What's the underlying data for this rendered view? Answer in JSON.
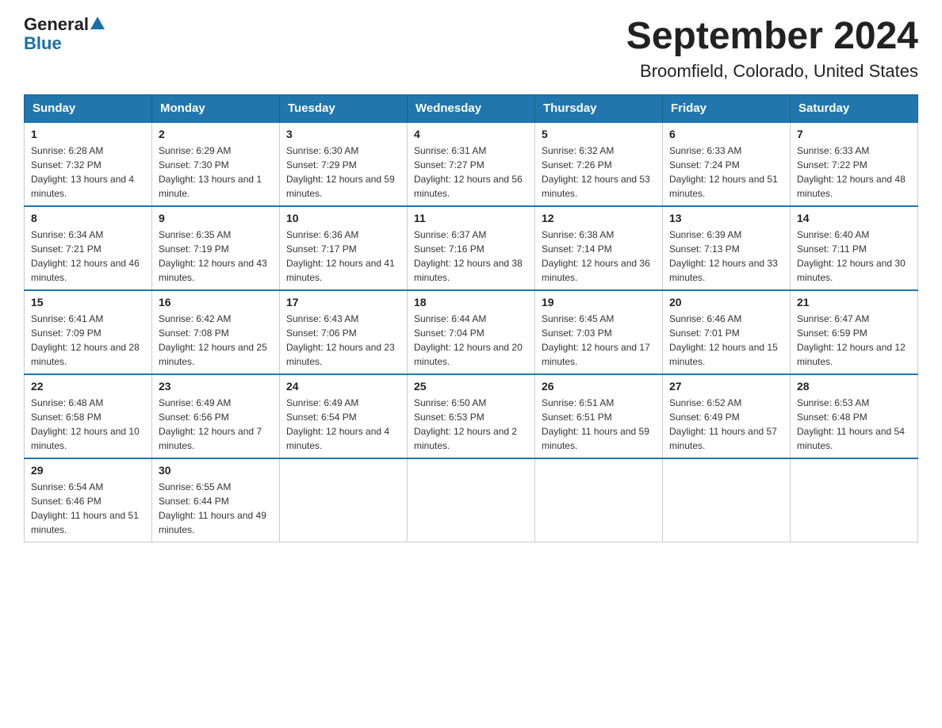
{
  "header": {
    "logo_general": "General",
    "logo_blue": "Blue",
    "title": "September 2024",
    "subtitle": "Broomfield, Colorado, United States"
  },
  "days_of_week": [
    "Sunday",
    "Monday",
    "Tuesday",
    "Wednesday",
    "Thursday",
    "Friday",
    "Saturday"
  ],
  "weeks": [
    [
      {
        "day": "1",
        "sunrise": "6:28 AM",
        "sunset": "7:32 PM",
        "daylight": "13 hours and 4 minutes."
      },
      {
        "day": "2",
        "sunrise": "6:29 AM",
        "sunset": "7:30 PM",
        "daylight": "13 hours and 1 minute."
      },
      {
        "day": "3",
        "sunrise": "6:30 AM",
        "sunset": "7:29 PM",
        "daylight": "12 hours and 59 minutes."
      },
      {
        "day": "4",
        "sunrise": "6:31 AM",
        "sunset": "7:27 PM",
        "daylight": "12 hours and 56 minutes."
      },
      {
        "day": "5",
        "sunrise": "6:32 AM",
        "sunset": "7:26 PM",
        "daylight": "12 hours and 53 minutes."
      },
      {
        "day": "6",
        "sunrise": "6:33 AM",
        "sunset": "7:24 PM",
        "daylight": "12 hours and 51 minutes."
      },
      {
        "day": "7",
        "sunrise": "6:33 AM",
        "sunset": "7:22 PM",
        "daylight": "12 hours and 48 minutes."
      }
    ],
    [
      {
        "day": "8",
        "sunrise": "6:34 AM",
        "sunset": "7:21 PM",
        "daylight": "12 hours and 46 minutes."
      },
      {
        "day": "9",
        "sunrise": "6:35 AM",
        "sunset": "7:19 PM",
        "daylight": "12 hours and 43 minutes."
      },
      {
        "day": "10",
        "sunrise": "6:36 AM",
        "sunset": "7:17 PM",
        "daylight": "12 hours and 41 minutes."
      },
      {
        "day": "11",
        "sunrise": "6:37 AM",
        "sunset": "7:16 PM",
        "daylight": "12 hours and 38 minutes."
      },
      {
        "day": "12",
        "sunrise": "6:38 AM",
        "sunset": "7:14 PM",
        "daylight": "12 hours and 36 minutes."
      },
      {
        "day": "13",
        "sunrise": "6:39 AM",
        "sunset": "7:13 PM",
        "daylight": "12 hours and 33 minutes."
      },
      {
        "day": "14",
        "sunrise": "6:40 AM",
        "sunset": "7:11 PM",
        "daylight": "12 hours and 30 minutes."
      }
    ],
    [
      {
        "day": "15",
        "sunrise": "6:41 AM",
        "sunset": "7:09 PM",
        "daylight": "12 hours and 28 minutes."
      },
      {
        "day": "16",
        "sunrise": "6:42 AM",
        "sunset": "7:08 PM",
        "daylight": "12 hours and 25 minutes."
      },
      {
        "day": "17",
        "sunrise": "6:43 AM",
        "sunset": "7:06 PM",
        "daylight": "12 hours and 23 minutes."
      },
      {
        "day": "18",
        "sunrise": "6:44 AM",
        "sunset": "7:04 PM",
        "daylight": "12 hours and 20 minutes."
      },
      {
        "day": "19",
        "sunrise": "6:45 AM",
        "sunset": "7:03 PM",
        "daylight": "12 hours and 17 minutes."
      },
      {
        "day": "20",
        "sunrise": "6:46 AM",
        "sunset": "7:01 PM",
        "daylight": "12 hours and 15 minutes."
      },
      {
        "day": "21",
        "sunrise": "6:47 AM",
        "sunset": "6:59 PM",
        "daylight": "12 hours and 12 minutes."
      }
    ],
    [
      {
        "day": "22",
        "sunrise": "6:48 AM",
        "sunset": "6:58 PM",
        "daylight": "12 hours and 10 minutes."
      },
      {
        "day": "23",
        "sunrise": "6:49 AM",
        "sunset": "6:56 PM",
        "daylight": "12 hours and 7 minutes."
      },
      {
        "day": "24",
        "sunrise": "6:49 AM",
        "sunset": "6:54 PM",
        "daylight": "12 hours and 4 minutes."
      },
      {
        "day": "25",
        "sunrise": "6:50 AM",
        "sunset": "6:53 PM",
        "daylight": "12 hours and 2 minutes."
      },
      {
        "day": "26",
        "sunrise": "6:51 AM",
        "sunset": "6:51 PM",
        "daylight": "11 hours and 59 minutes."
      },
      {
        "day": "27",
        "sunrise": "6:52 AM",
        "sunset": "6:49 PM",
        "daylight": "11 hours and 57 minutes."
      },
      {
        "day": "28",
        "sunrise": "6:53 AM",
        "sunset": "6:48 PM",
        "daylight": "11 hours and 54 minutes."
      }
    ],
    [
      {
        "day": "29",
        "sunrise": "6:54 AM",
        "sunset": "6:46 PM",
        "daylight": "11 hours and 51 minutes."
      },
      {
        "day": "30",
        "sunrise": "6:55 AM",
        "sunset": "6:44 PM",
        "daylight": "11 hours and 49 minutes."
      },
      null,
      null,
      null,
      null,
      null
    ]
  ]
}
